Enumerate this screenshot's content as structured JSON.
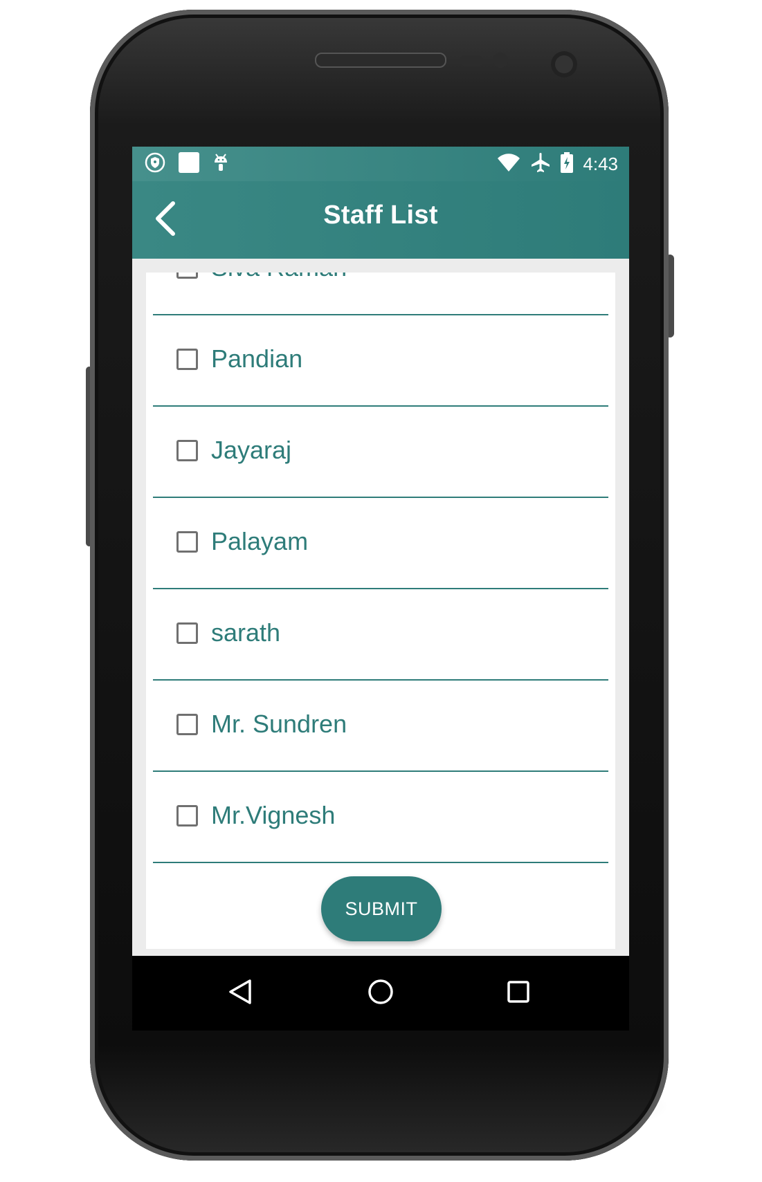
{
  "status_bar": {
    "time": "4:43",
    "left_icons": [
      "shield-icon",
      "square-notification-icon",
      "android-icon"
    ],
    "right_icons": [
      "wifi-icon",
      "airplane-icon",
      "battery-charging-icon"
    ]
  },
  "app_bar": {
    "title": "Staff List",
    "back_icon": "chevron-left-icon"
  },
  "staff_list": {
    "items": [
      {
        "label": "Siva Raman",
        "checked": false
      },
      {
        "label": "Pandian",
        "checked": false
      },
      {
        "label": "Jayaraj",
        "checked": false
      },
      {
        "label": "Palayam",
        "checked": false
      },
      {
        "label": "sarath",
        "checked": false
      },
      {
        "label": "Mr. Sundren",
        "checked": false
      },
      {
        "label": "Mr.Vignesh",
        "checked": false
      }
    ]
  },
  "submit_label": "SUBMIT",
  "nav": {
    "back_icon": "triangle-back-icon",
    "home_icon": "circle-home-icon",
    "recents_icon": "square-recents-icon"
  },
  "colors": {
    "primary": "#2e7c79",
    "background": "#ececec",
    "checkbox_border": "#707070"
  }
}
